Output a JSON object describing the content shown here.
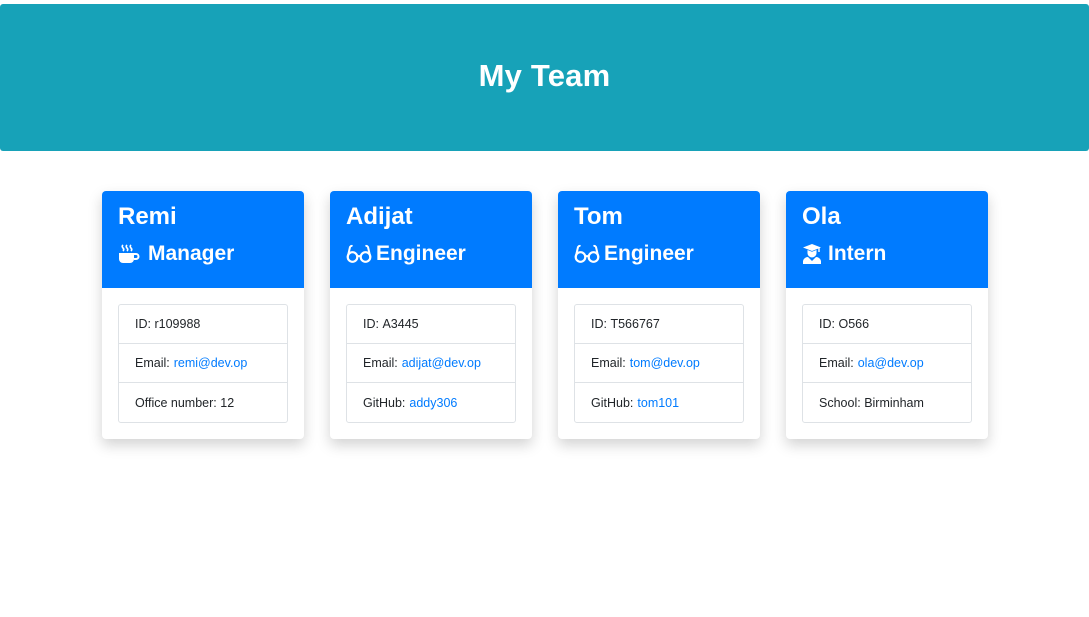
{
  "header": {
    "title": "My Team"
  },
  "colors": {
    "header_bg": "#17a2b8",
    "card_header_bg": "#007bff",
    "link": "#007bff"
  },
  "cards": [
    {
      "name": "Remi",
      "role": "Manager",
      "role_icon": "coffee-icon",
      "id_label": "ID:",
      "id": "r109988",
      "email_label": "Email:",
      "email": "remi@dev.op",
      "extra_label": "Office number:",
      "extra": "12"
    },
    {
      "name": "Adijat",
      "role": "Engineer",
      "role_icon": "glasses-icon",
      "id_label": "ID:",
      "id": "A3445",
      "email_label": "Email:",
      "email": "adijat@dev.op",
      "extra_label": "GitHub:",
      "extra": "addy306"
    },
    {
      "name": "Tom",
      "role": "Engineer",
      "role_icon": "glasses-icon",
      "id_label": "ID:",
      "id": "T566767",
      "email_label": "Email:",
      "email": "tom@dev.op",
      "extra_label": "GitHub:",
      "extra": "tom101"
    },
    {
      "name": "Ola",
      "role": "Intern",
      "role_icon": "graduate-icon",
      "id_label": "ID:",
      "id": "O566",
      "email_label": "Email:",
      "email": "ola@dev.op",
      "extra_label": "School:",
      "extra": "Birminham"
    }
  ]
}
